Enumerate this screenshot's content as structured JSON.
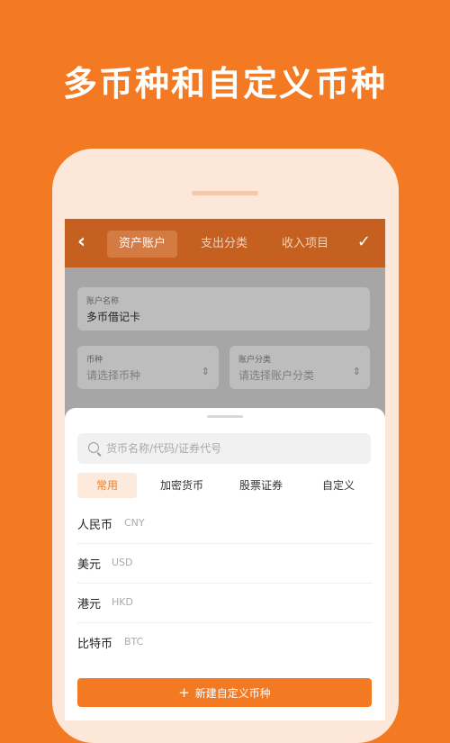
{
  "headline": "多币种和自定义币种",
  "header": {
    "back_icon": "‹",
    "tabs": [
      {
        "label": "资产账户",
        "active": true
      },
      {
        "label": "支出分类",
        "active": false
      },
      {
        "label": "收入项目",
        "active": false
      }
    ],
    "confirm_icon": "✓"
  },
  "form": {
    "account_name_label": "账户名称",
    "account_name_value": "多币借记卡",
    "currency_label": "币种",
    "currency_placeholder": "请选择币种",
    "category_label": "账户分类",
    "category_placeholder": "请选择账户分类",
    "select_arrow_icon": "⇕"
  },
  "sheet": {
    "search_placeholder": "货币名称/代码/证券代号",
    "tabs": [
      {
        "label": "常用",
        "active": true
      },
      {
        "label": "加密货币",
        "active": false
      },
      {
        "label": "股票证券",
        "active": false
      },
      {
        "label": "自定义",
        "active": false
      }
    ],
    "currencies": [
      {
        "name": "人民币",
        "code": "CNY"
      },
      {
        "name": "美元",
        "code": "USD"
      },
      {
        "name": "港元",
        "code": "HKD"
      },
      {
        "name": "比特币",
        "code": "BTC"
      }
    ],
    "add_button_label": "新建自定义币种",
    "add_button_icon": "+"
  },
  "colors": {
    "brand": "#F37A22",
    "header_dimmed": "#C56020",
    "phone_frame": "#FCE7D8"
  }
}
